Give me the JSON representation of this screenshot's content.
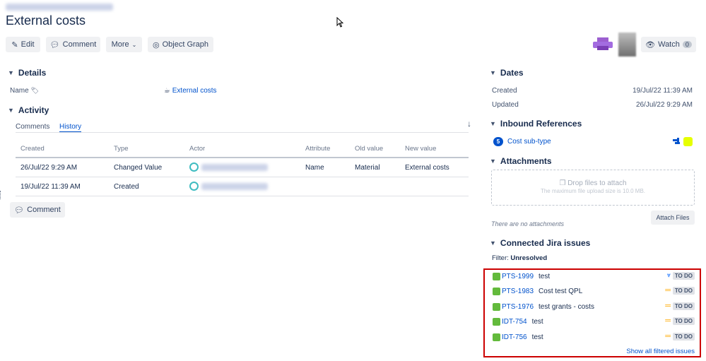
{
  "page": {
    "title": "External costs"
  },
  "toolbar": {
    "edit": "Edit",
    "comment": "Comment",
    "more": "More",
    "object_graph": "Object Graph",
    "watch": "Watch",
    "watch_count": "0"
  },
  "details": {
    "heading": "Details",
    "name_label": "Name",
    "name_value": "External costs"
  },
  "activity": {
    "heading": "Activity",
    "tabs": [
      "Comments",
      "History"
    ],
    "columns": [
      "Created",
      "Type",
      "Actor",
      "Attribute",
      "Old value",
      "New value"
    ],
    "rows": [
      {
        "created": "26/Jul/22 9:29 AM",
        "type": "Changed Value",
        "attribute": "Name",
        "old": "Material",
        "new": "External costs"
      },
      {
        "created": "19/Jul/22 11:39 AM",
        "type": "Created",
        "attribute": "",
        "old": "",
        "new": ""
      }
    ],
    "comment_button": "Comment"
  },
  "dates": {
    "heading": "Dates",
    "created_label": "Created",
    "created_value": "19/Jul/22 11:39 AM",
    "updated_label": "Updated",
    "updated_value": "26/Jul/22 9:29 AM"
  },
  "inbound": {
    "heading": "Inbound References",
    "count": "5",
    "item": "Cost sub-type"
  },
  "attachments": {
    "heading": "Attachments",
    "drop": "Drop files to attach",
    "max": "The maximum file upload size is 10.0 MB.",
    "attach_button": "Attach Files",
    "none": "There are no attachments"
  },
  "jira": {
    "heading": "Connected Jira issues",
    "filter_label": "Filter:",
    "filter_value": "Unresolved",
    "issues": [
      {
        "key": "PTS-1999",
        "summary": "test",
        "status": "TO DO",
        "priority": "low"
      },
      {
        "key": "PTS-1983",
        "summary": "Cost test QPL",
        "status": "TO DO",
        "priority": "medium"
      },
      {
        "key": "PTS-1976",
        "summary": "test grants - costs",
        "status": "TO DO",
        "priority": "medium"
      },
      {
        "key": "IDT-754",
        "summary": "test",
        "status": "TO DO",
        "priority": "medium"
      },
      {
        "key": "IDT-756",
        "summary": "test",
        "status": "TO DO",
        "priority": "medium"
      }
    ],
    "show_all": "Show all filtered issues"
  },
  "colors": {
    "accent": "#0052cc",
    "highlight_border": "#cc0000",
    "issue_green": "#63ba3c",
    "priority_medium": "#ffab00",
    "priority_low": "#0065ff"
  }
}
